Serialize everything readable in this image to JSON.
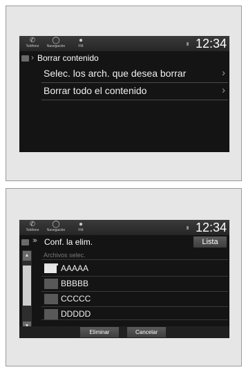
{
  "screens": [
    {
      "status": {
        "phone_label": "Teléfono",
        "nav_label": "Navegación",
        "fm_label": "FM",
        "clock": "12:34"
      },
      "title": "Borrar contenido",
      "menu": [
        {
          "label": "Selec. los arch. que desea borrar"
        },
        {
          "label": "Borrar todo el contenido"
        }
      ]
    },
    {
      "status": {
        "phone_label": "Teléfono",
        "nav_label": "Navegación",
        "fm_label": "FM",
        "clock": "12:34"
      },
      "title": "Conf. la elim.",
      "list_button": "Lista",
      "subheader": "Archivos selec.",
      "files": [
        {
          "name": "AAAAA",
          "icon": "folder-icon"
        },
        {
          "name": "BBBBB",
          "icon": "file-icon"
        },
        {
          "name": "CCCCC",
          "icon": "file-icon"
        },
        {
          "name": "DDDDD",
          "icon": "file-icon"
        }
      ],
      "buttons": {
        "delete": "Eliminar",
        "cancel": "Cancelar"
      }
    }
  ],
  "colors": {
    "screen": "#141414",
    "text": "#f0f0f0",
    "divider": "#4a4a4a"
  }
}
